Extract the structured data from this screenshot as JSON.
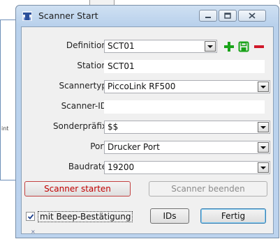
{
  "background": {
    "fragment_text": "int"
  },
  "window": {
    "title": "Scanner Start",
    "icons": [
      "app-scanner-icon",
      "minimize-icon",
      "maximize-icon",
      "close-icon"
    ]
  },
  "form": {
    "definition": {
      "label": "Definition",
      "value": "SCT01"
    },
    "station": {
      "label": "Station",
      "value": "SCT01"
    },
    "scannertyp": {
      "label": "Scannertyp",
      "value": "PiccoLink RF500"
    },
    "scanner_id": {
      "label": "Scanner-ID",
      "value": ""
    },
    "sonderpraefix": {
      "label": "Sonderpräfix",
      "value": "$$"
    },
    "port": {
      "label": "Port",
      "value": "Drucker Port"
    },
    "baudrate": {
      "label": "Baudrate",
      "value": "19200"
    }
  },
  "definition_actions": [
    "add-icon",
    "save-icon",
    "remove-icon"
  ],
  "colors": {
    "add": "#1aa31a",
    "save": "#1aa31a",
    "remove": "#d0192a",
    "start_text": "#c00000"
  },
  "buttons": {
    "start": "Scanner starten",
    "stop": "Scanner beenden",
    "ids": "IDs",
    "done": "Fertig"
  },
  "checkbox": {
    "label": "mit Beep-Bestätigung",
    "checked": true
  }
}
